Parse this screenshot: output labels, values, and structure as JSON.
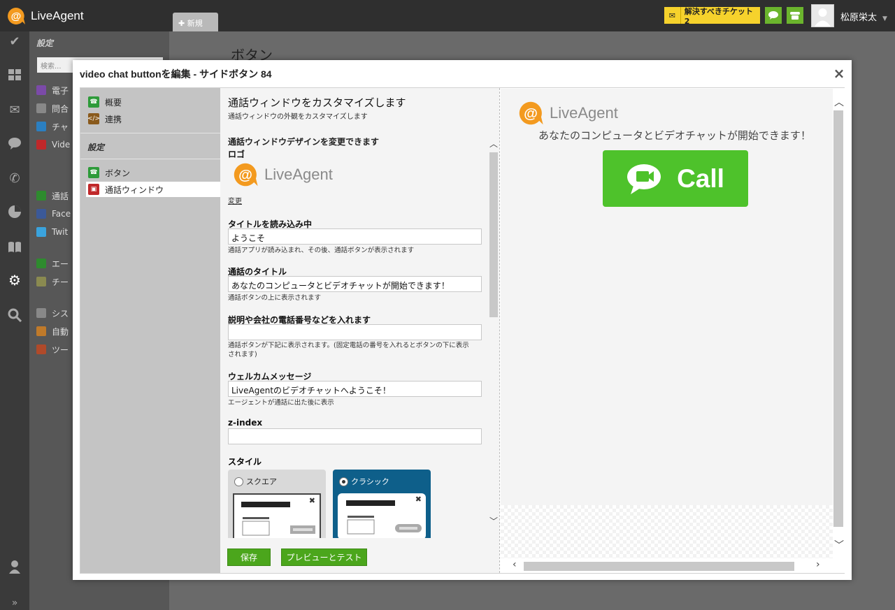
{
  "app": {
    "logo_text": "LiveAgent",
    "new_tab_label": "新規",
    "ticket_badge": "解決すべきチケット 2",
    "user_name": "松原栄太",
    "page_title": "ボタン"
  },
  "submenu": {
    "header": "設定",
    "search_placeholder": "検索...",
    "items": [
      "電子",
      "問合",
      "チャ",
      "Vide",
      "通話",
      "Face",
      "Twit",
      "エー",
      "チー",
      "シス",
      "自動",
      "ツー"
    ]
  },
  "dialog": {
    "title": "video chat buttonを編集 - サイドボタン 84",
    "close": "×",
    "nav": {
      "overview": "概要",
      "integration": "連携",
      "settings_header": "設定",
      "button": "ボタン",
      "call_window": "通話ウィンドウ"
    },
    "form": {
      "heading": "通話ウィンドウをカスタマイズします",
      "subheading": "通話ウィンドウの外観をカスタマイズします",
      "design_heading": "通話ウィンドウデザインを変更できます",
      "logo_label": "ロゴ",
      "logo_text": "LiveAgent",
      "change_link": "変更",
      "loading_title_label": "タイトルを読み込み中",
      "loading_title_value": "ようこそ",
      "loading_title_hint": "通話アプリが読み込まれ、その後、通話ボタンが表示されます",
      "call_title_label": "通話のタイトル",
      "call_title_value": "あなたのコンピュータとビデオチャットが開始できます！",
      "call_title_hint": "通話ボタンの上に表示されます",
      "description_label": "説明や会社の電話番号などを入れます",
      "description_value": "",
      "description_hint": "通話ボタンが下記に表示されます。(固定電話の番号を入れるとボタンの下に表示されます)",
      "welcome_label": "ウェルカムメッセージ",
      "welcome_value": "LiveAgentのビデオチャットへようこそ！",
      "welcome_hint": "エージェントが通話に出た後に表示",
      "zindex_label": "z-index",
      "zindex_value": "",
      "style_label": "スタイル",
      "style_square": "スクエア",
      "style_classic": "クラシック",
      "selected_style": "クラシック"
    },
    "buttons": {
      "save": "保存",
      "preview_test": "プレビューとテスト"
    },
    "preview": {
      "logo_text": "LiveAgent",
      "title": "あなたのコンピュータとビデオチャットが開始できます！",
      "call_label": "Call"
    }
  },
  "colors": {
    "accent_green": "#4ec22b",
    "button_green": "#4ba61c",
    "brand_orange": "#f39a1f",
    "classic_blue": "#0e5f8a",
    "ticket_yellow": "#f6d22c"
  }
}
